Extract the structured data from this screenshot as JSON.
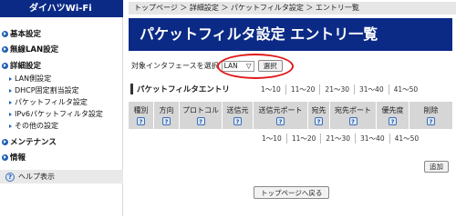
{
  "sidebar": {
    "brand": "ダイハツWi-Fi",
    "menu": {
      "basic": "基本設定",
      "wireless_lan": "無線LAN設定",
      "detail": "詳細設定",
      "maintenance": "メンテナンス",
      "info": "情報"
    },
    "sub_items": [
      "LAN側設定",
      "DHCP固定割当設定",
      "パケットフィルタ設定",
      "IPv6パケットフィルタ設定",
      "その他の設定"
    ],
    "help_label": "ヘルプ表示"
  },
  "header": {
    "breadcrumb": "トップページ ＞ 詳細設定 ＞ パケットフィルタ設定 ＞ エントリ一覧",
    "title": "パケットフィルタ設定 エントリ一覧"
  },
  "interface": {
    "label": "対象インタフェースを選択",
    "selected_value": "LAN",
    "select_button": "選択"
  },
  "entry": {
    "title": "パケットフィルタエントリ",
    "pages": [
      "1～10",
      "11～20",
      "21～30",
      "31～40",
      "41～50"
    ]
  },
  "table": {
    "columns": [
      "種別",
      "方向",
      "プロトコル",
      "送信元",
      "送信元ポート",
      "宛先",
      "宛先ポート",
      "優先度",
      "削除"
    ]
  },
  "buttons": {
    "add": "追加",
    "back_top": "トップページへ戻る"
  },
  "colors": {
    "brand_blue": "#0b2a86",
    "highlight_red": "#e11919",
    "table_header": "#d6d6d6"
  }
}
